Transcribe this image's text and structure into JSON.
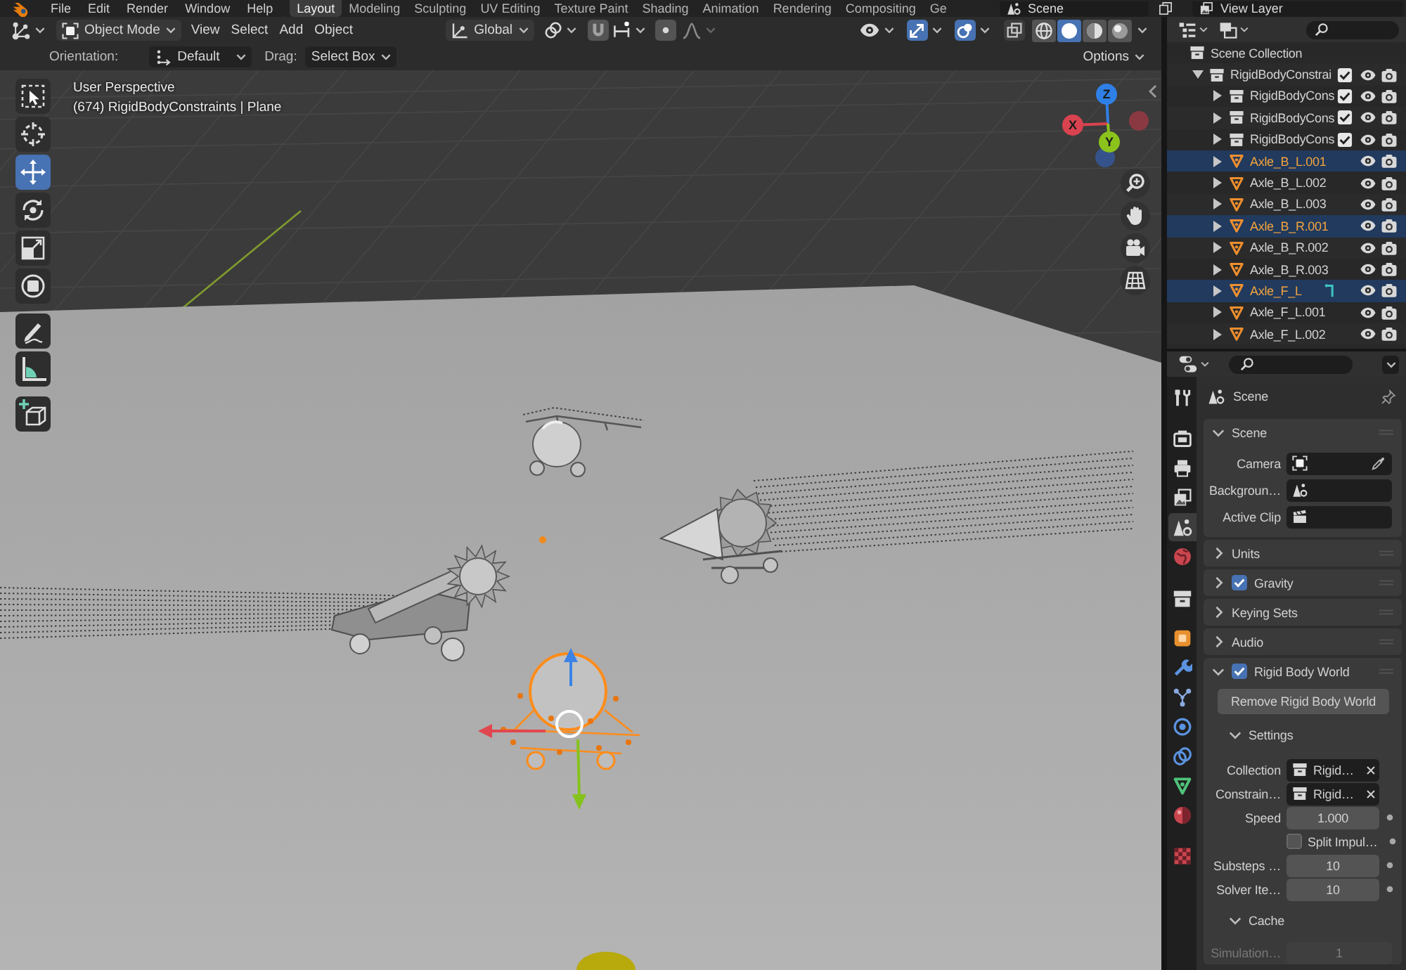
{
  "top_bar": {
    "menus": [
      "File",
      "Edit",
      "Render",
      "Window",
      "Help"
    ],
    "workspaces": [
      {
        "label": "Layout",
        "selected": true
      },
      {
        "label": "Modeling",
        "selected": false
      },
      {
        "label": "Sculpting",
        "selected": false
      },
      {
        "label": "UV Editing",
        "selected": false
      },
      {
        "label": "Texture Paint",
        "selected": false
      },
      {
        "label": "Shading",
        "selected": false
      },
      {
        "label": "Animation",
        "selected": false
      },
      {
        "label": "Rendering",
        "selected": false
      },
      {
        "label": "Compositing",
        "selected": false
      },
      {
        "label": "Ge",
        "selected": false
      }
    ],
    "scene": "Scene",
    "view_layer": "View Layer"
  },
  "viewport": {
    "header": {
      "mode": "Object Mode",
      "menus": [
        "View",
        "Select",
        "Add",
        "Object"
      ],
      "orientation": "Global",
      "snap": false,
      "proportional": false,
      "gizmos": true,
      "overlays": true,
      "xray": false,
      "shading": [
        {
          "kind": "wireframe",
          "selected": false
        },
        {
          "kind": "solid",
          "selected": true
        },
        {
          "kind": "material",
          "selected": false
        },
        {
          "kind": "rendered",
          "selected": false
        }
      ]
    },
    "tool_settings": {
      "orientation_label": "Orientation:",
      "orientation": "Default",
      "drag_label": "Drag:",
      "drag": "Select Box",
      "options": "Options"
    },
    "info": [
      "User Perspective",
      "(674) RigidBodyConstraints | Plane"
    ],
    "tools": [
      {
        "kind": "select_box",
        "selected": false
      },
      {
        "kind": "cursor",
        "selected": false
      },
      {
        "kind": "move",
        "selected": true
      },
      {
        "kind": "rotate",
        "selected": false
      },
      {
        "kind": "scale",
        "selected": false
      },
      {
        "kind": "transform",
        "selected": false
      },
      {
        "kind": "annotate",
        "selected": false
      },
      {
        "kind": "measure",
        "selected": false
      },
      {
        "kind": "add_cube",
        "selected": false
      }
    ],
    "axes": [
      {
        "kind": "z",
        "label": "Z"
      },
      {
        "kind": "x",
        "label": "X"
      },
      {
        "kind": "y",
        "label": "Y"
      }
    ]
  },
  "outliner": {
    "rows": [
      {
        "label": "Scene Collection",
        "kind": "scene_collection",
        "selected": false,
        "children": [
          {
            "label": "RigidBodyConstrai",
            "kind": "collection",
            "expanded": true,
            "selected": false,
            "checked": true,
            "children": [
              {
                "label": "RigidBodyCons",
                "kind": "collection",
                "expanded": false,
                "selected": false,
                "checked": true
              },
              {
                "label": "RigidBodyCons",
                "kind": "collection",
                "expanded": false,
                "selected": false,
                "checked": true
              },
              {
                "label": "RigidBodyCons",
                "kind": "collection",
                "expanded": false,
                "selected": false,
                "checked": true
              },
              {
                "label": "Axle_B_L.001",
                "kind": "object",
                "expanded": false,
                "selected": true,
                "hook_icon": false
              },
              {
                "label": "Axle_B_L.002",
                "kind": "object",
                "expanded": false,
                "selected": false,
                "hook_icon": false
              },
              {
                "label": "Axle_B_L.003",
                "kind": "object",
                "expanded": false,
                "selected": false,
                "hook_icon": false
              },
              {
                "label": "Axle_B_R.001",
                "kind": "object",
                "expanded": false,
                "selected": true,
                "hook_icon": false
              },
              {
                "label": "Axle_B_R.002",
                "kind": "object",
                "expanded": false,
                "selected": false,
                "hook_icon": false
              },
              {
                "label": "Axle_B_R.003",
                "kind": "object",
                "expanded": false,
                "selected": false,
                "hook_icon": false
              },
              {
                "label": "Axle_F_L",
                "kind": "object",
                "expanded": false,
                "selected": true,
                "hook_icon": true
              },
              {
                "label": "Axle_F_L.001",
                "kind": "object",
                "expanded": false,
                "selected": false,
                "hook_icon": false
              },
              {
                "label": "Axle_F_L.002",
                "kind": "object",
                "expanded": false,
                "selected": false,
                "hook_icon": false
              }
            ]
          }
        ]
      }
    ]
  },
  "properties": {
    "tabs": [
      {
        "kind": "tool",
        "selected": false
      },
      {
        "kind": "render",
        "selected": false
      },
      {
        "kind": "output",
        "selected": false
      },
      {
        "kind": "view_layer",
        "selected": false
      },
      {
        "kind": "scene",
        "selected": true
      },
      {
        "kind": "world",
        "selected": false
      },
      {
        "kind": "collection",
        "selected": false
      },
      {
        "kind": "object",
        "selected": false
      },
      {
        "kind": "modifiers",
        "selected": false
      },
      {
        "kind": "particles",
        "selected": false
      },
      {
        "kind": "physics",
        "selected": false
      },
      {
        "kind": "constraints",
        "selected": false
      },
      {
        "kind": "data",
        "selected": false
      },
      {
        "kind": "material",
        "selected": false
      },
      {
        "kind": "texture",
        "selected": false
      }
    ],
    "context": "Scene",
    "panels": [
      {
        "title": "Scene",
        "expanded": true,
        "rows": [
          {
            "kind": "object_id",
            "label": "Camera",
            "eyedropper": true
          },
          {
            "kind": "scene_id",
            "label": "Backgroun…",
            "eyedropper": false
          },
          {
            "kind": "clip_id",
            "label": "Active Clip",
            "eyedropper": false
          }
        ]
      },
      {
        "title": "Units",
        "expanded": false
      },
      {
        "title": "Gravity",
        "expanded": false,
        "checked": true
      },
      {
        "title": "Keying Sets",
        "expanded": false
      },
      {
        "title": "Audio",
        "expanded": false
      },
      {
        "title": "Rigid Body World",
        "expanded": true,
        "checked": true,
        "button": "Remove Rigid Body World",
        "subpanels": [
          {
            "title": "Settings",
            "expanded": true,
            "rows": [
              {
                "kind": "collection_id",
                "label": "Collection",
                "value": "Rigid…",
                "clear": true,
                "keyframe_dot": false
              },
              {
                "kind": "collection_id",
                "label": "Constrain…",
                "value": "Rigid…",
                "clear": true,
                "keyframe_dot": false
              },
              {
                "kind": "number",
                "label": "Speed",
                "value": "1.000",
                "keyframe_dot": true
              },
              {
                "kind": "checkbox",
                "label": "Split Impul…",
                "checked": false,
                "keyframe_dot": true
              },
              {
                "kind": "number",
                "label": "Substeps …",
                "value": "10",
                "keyframe_dot": true
              },
              {
                "kind": "number",
                "label": "Solver Ite…",
                "value": "10",
                "keyframe_dot": true
              }
            ]
          },
          {
            "title": "Cache",
            "expanded": true,
            "rows": [
              {
                "kind": "number",
                "label": "Simulation…",
                "value": "1",
                "disabled": true
              }
            ]
          }
        ]
      }
    ]
  }
}
